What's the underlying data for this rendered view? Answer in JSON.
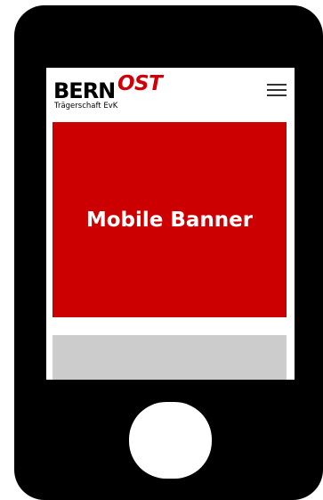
{
  "logo": {
    "brand_main": "BERN",
    "brand_accent": "OST",
    "subtitle": "Trägerschaft EvK",
    "accent_color": "#d0000a"
  },
  "header": {
    "menu_icon": "hamburger-menu-icon"
  },
  "banner": {
    "label": "Mobile Banner",
    "background_color": "#cc0000"
  },
  "placeholder": {
    "background_color": "#cccccc"
  },
  "device": {
    "frame_color": "#000000"
  }
}
